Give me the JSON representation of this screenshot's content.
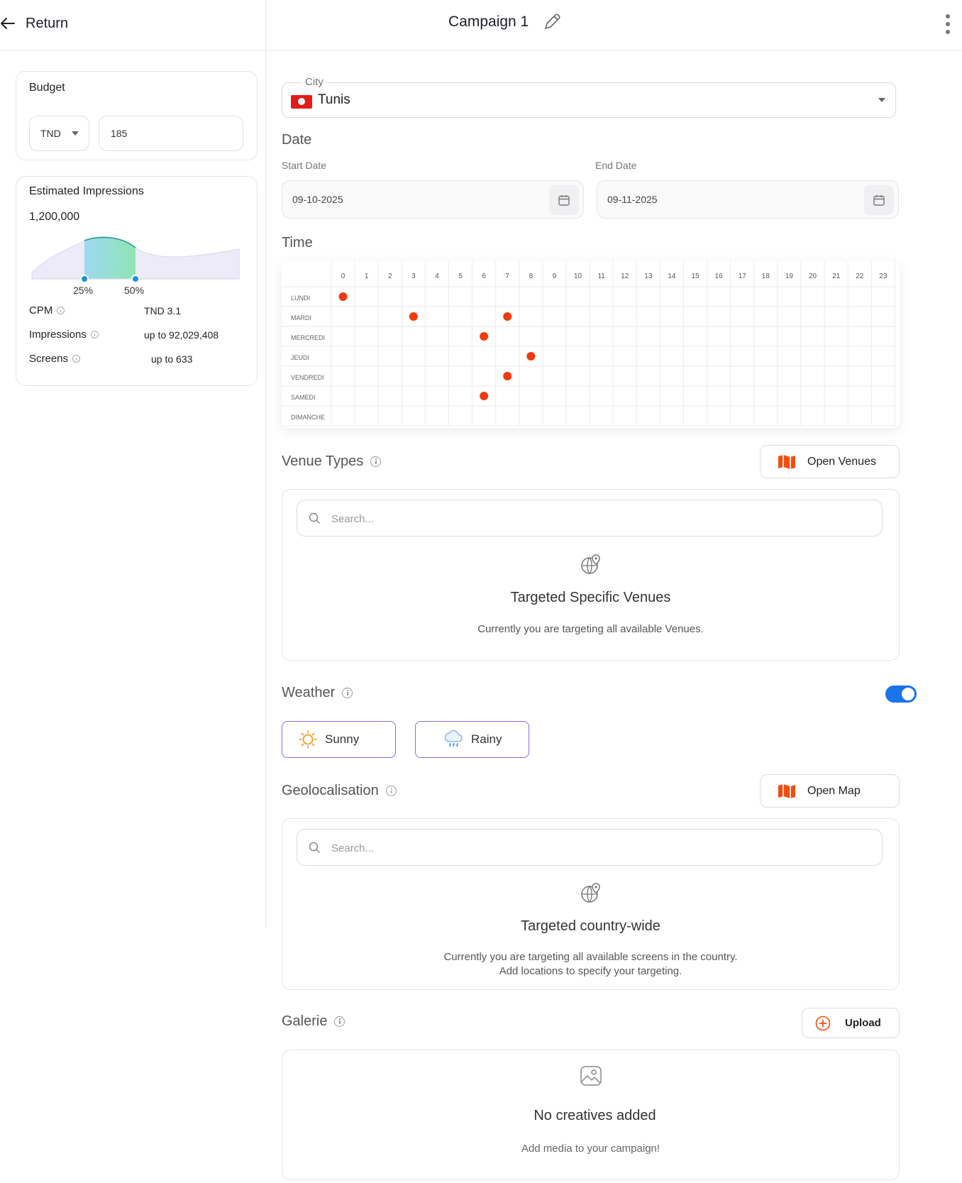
{
  "header": {
    "return_label": "Return",
    "campaign_title": "Campaign 1"
  },
  "budget": {
    "label": "Budget",
    "currency": "TND",
    "amount": "185"
  },
  "impressions": {
    "label": "Estimated Impressions",
    "value": "1,200,000",
    "range_low": "25%",
    "range_high": "50%",
    "range_fraction": [
      0.25,
      0.5
    ],
    "stats": [
      {
        "label": "CPM",
        "value": "TND 3.1"
      },
      {
        "label": "Impressions",
        "value": "up to 92,029,408"
      },
      {
        "label": "Screens",
        "value": "up to 633"
      }
    ]
  },
  "city": {
    "legend": "City",
    "value": "Tunis"
  },
  "date": {
    "title": "Date",
    "start_label": "Start Date",
    "start_value": "09-10-2025",
    "end_label": "End Date",
    "end_value": "09-11-2025"
  },
  "time": {
    "title": "Time",
    "hours": [
      "0",
      "1",
      "2",
      "3",
      "4",
      "5",
      "6",
      "7",
      "8",
      "9",
      "10",
      "11",
      "12",
      "13",
      "14",
      "15",
      "16",
      "17",
      "18",
      "19",
      "20",
      "21",
      "22",
      "23"
    ],
    "days": [
      "LUNDI",
      "MARDI",
      "MERCREDI",
      "JEUDI",
      "VENDREDI",
      "SAMEDI",
      "DIMANCHE"
    ],
    "selected": [
      {
        "day": 0,
        "hour": 0
      },
      {
        "day": 1,
        "hour": 3
      },
      {
        "day": 1,
        "hour": 7
      },
      {
        "day": 2,
        "hour": 6
      },
      {
        "day": 3,
        "hour": 8
      },
      {
        "day": 4,
        "hour": 7
      },
      {
        "day": 5,
        "hour": 6
      }
    ],
    "dot_color": "#f23a0c"
  },
  "venues": {
    "title": "Venue Types",
    "open_button": "Open Venues",
    "search_placeholder": "Search...",
    "empty_title": "Targeted Specific Venues",
    "empty_sub": "Currently you are targeting all available Venues."
  },
  "weather": {
    "title": "Weather",
    "enabled": true,
    "options": [
      "Sunny",
      "Rainy"
    ]
  },
  "geo": {
    "title": "Geolocalisation",
    "open_button": "Open Map",
    "search_placeholder": "Search...",
    "empty_title": "Targeted country-wide",
    "empty_sub_line1": "Currently you are targeting all available screens in the country.",
    "empty_sub_line2": "Add locations to specify your targeting."
  },
  "gallery": {
    "title": "Galerie",
    "upload_button": "Upload",
    "empty_title": "No creatives added",
    "empty_sub": "Add media  to your campaign!"
  },
  "colors": {
    "accent": "#1a73e8",
    "brand_orange": "#f04e0f",
    "chip_border": "#8a6be0"
  }
}
